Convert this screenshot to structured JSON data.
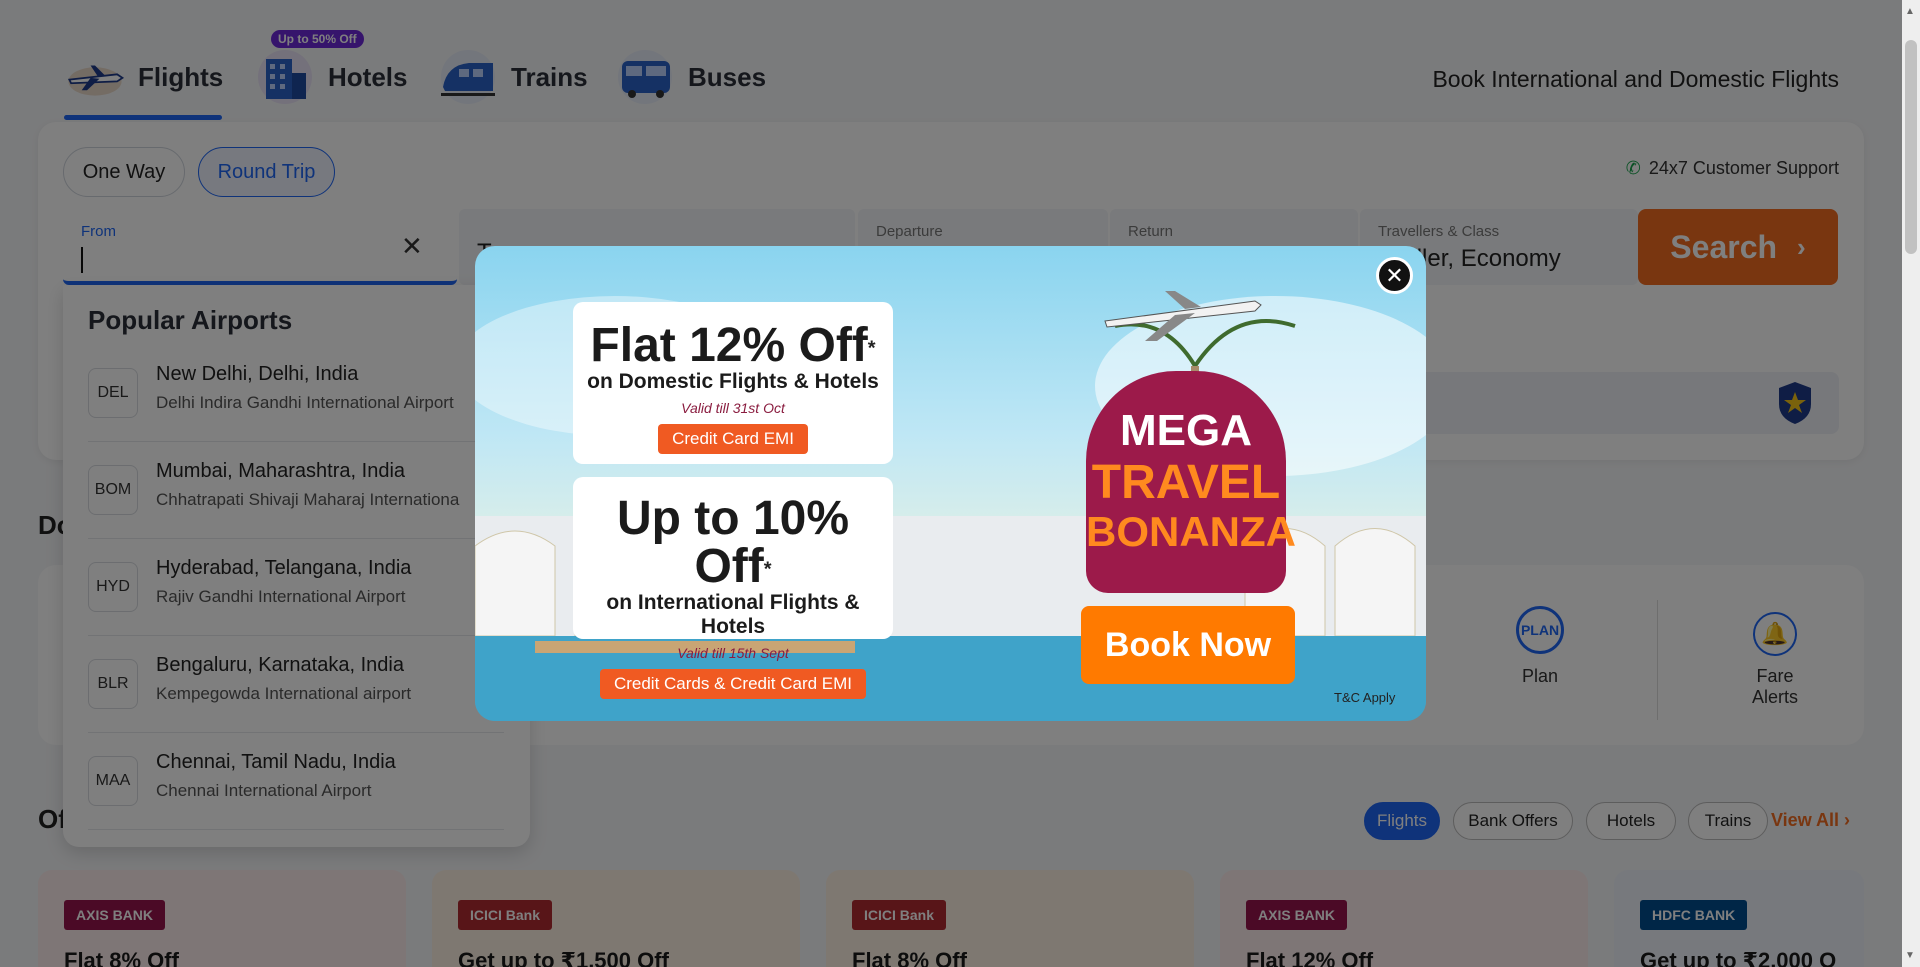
{
  "nav": {
    "tabs": [
      {
        "label": "Flights"
      },
      {
        "label": "Hotels",
        "badge": "Up to 50% Off"
      },
      {
        "label": "Trains"
      },
      {
        "label": "Buses"
      }
    ],
    "tagline": "Book International and Domestic Flights"
  },
  "search": {
    "trip_types": [
      "One Way",
      "Round Trip"
    ],
    "support": "24x7 Customer Support",
    "from_label": "From",
    "to_label": "T",
    "departure_label": "Departure",
    "return_label": "Return",
    "travellers_label": "Travellers & Class",
    "travellers_value": "aveller, Economy",
    "search_button": "Search"
  },
  "popular": {
    "title": "Popular Airports",
    "airports": [
      {
        "code": "DEL",
        "city": "New Delhi, Delhi, India",
        "name": "Delhi Indira Gandhi International Airport"
      },
      {
        "code": "BOM",
        "city": "Mumbai, Maharashtra, India",
        "name": "Chhatrapati Shivaji Maharaj Internationa"
      },
      {
        "code": "HYD",
        "city": "Hyderabad, Telangana, India",
        "name": "Rajiv Gandhi International Airport"
      },
      {
        "code": "BLR",
        "city": "Bengaluru, Karnataka, India",
        "name": "Kempegowda International airport"
      },
      {
        "code": "MAA",
        "city": "Chennai, Tamil Nadu, India",
        "name": "Chennai International Airport"
      }
    ]
  },
  "sections": {
    "do_partial": "Do",
    "of_partial": "Of"
  },
  "quick": [
    {
      "label": "Plan",
      "icon_text": "PLAN"
    },
    {
      "label_line1": "Fare",
      "label_line2": "Alerts"
    }
  ],
  "filters": [
    "Flights",
    "Bank Offers",
    "Hotels",
    "Trains"
  ],
  "view_all": "View All",
  "offer_cards": [
    {
      "bank": "AXIS BANK",
      "title": "Flat 8% Off"
    },
    {
      "bank": "ICICI Bank",
      "title": "Get up to ₹1,500 Off"
    },
    {
      "bank": "ICICI Bank",
      "title": "Flat 8% Off"
    },
    {
      "bank": "AXIS BANK",
      "title": "Flat 12% Off"
    },
    {
      "bank": "HDFC BANK",
      "title": "Get up to ₹2,000 O"
    }
  ],
  "modal": {
    "offer1_big": "Flat 12% Off",
    "offer1_star": "*",
    "offer1_sub": "on Domestic Flights & Hotels",
    "offer1_valid": "Valid till 31st Oct",
    "offer1_tag": "Credit Card EMI",
    "offer2_big": "Up to 10% Off",
    "offer2_star": "*",
    "offer2_sub": "on International Flights & Hotels",
    "offer2_valid": "Valid till 15th Sept",
    "offer2_tag": "Credit Cards & Credit Card EMI",
    "mega_line1": "MEGA",
    "mega_line2": "TRAVEL",
    "mega_line3": "BONANZA",
    "book_now": "Book Now",
    "tnc": "T&C Apply",
    "close": "✕"
  },
  "colors": {
    "accent": "#1e66f5",
    "brand_orange": "#f36c21",
    "badge_purple": "#6d28d9",
    "mega_bg": "#9c1a4a"
  }
}
